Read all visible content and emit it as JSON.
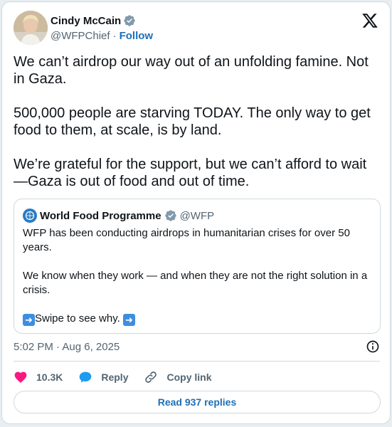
{
  "author": {
    "display_name": "Cindy McCain",
    "handle": "@WFPChief",
    "separator": "·",
    "follow_label": "Follow"
  },
  "tweet": {
    "text": "We can’t airdrop our way out of an unfolding famine. Not in Gaza.\n\n500,000 people are starving TODAY. The only way to get food to them, at scale, is by land.\n\nWe’re grateful for the support, but we can’t afford to wait—Gaza is out of food and out of time."
  },
  "quoted_tweet": {
    "display_name": "World Food Programme",
    "handle": "@WFP",
    "text_para1": "WFP has been conducting airdrops in humanitarian crises for over 50 years.",
    "text_para2": "We know when they work — and when they are not the right solution in a crisis.",
    "text_para3": "Swipe to see why."
  },
  "meta": {
    "timestamp": "5:02 PM · Aug 6, 2025"
  },
  "actions": {
    "likes_count": "10.3K",
    "reply_label": "Reply",
    "copy_link_label": "Copy link"
  },
  "read_replies_label": "Read 937 replies",
  "colors": {
    "like": "#f91880",
    "reply": "#1d9bf0",
    "link": "#1d6fb8",
    "verified": "#829aab"
  }
}
